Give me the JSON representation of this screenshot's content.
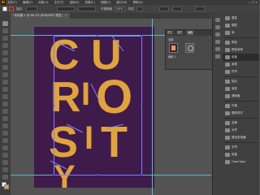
{
  "app": {
    "logo": "Ai"
  },
  "menu": [
    "文件(F)",
    "编辑(E)",
    "对象(O)",
    "文字(T)",
    "选择(S)",
    "效果(C)",
    "视图(V)",
    "窗口(W)",
    "帮助(H)"
  ],
  "window_controls": "— ☐ ✕",
  "control_bar": {
    "stroke_label": "描边",
    "opacity_label": "不透明度",
    "opacity_value": "100%",
    "style_label": "样式",
    "fill_color": "#ffffff",
    "stroke_color": "#d4463a"
  },
  "document_tab": {
    "label": "*未标题-1 @ 66.7% (RGB/GPU 预览)",
    "close": "×"
  },
  "artwork": {
    "letters": [
      "C",
      "U",
      "R",
      "I",
      "O",
      "S",
      "I",
      "T",
      "Y"
    ],
    "background_color": "#3f1b4b",
    "letter_color": "#e0a33d"
  },
  "panel": {
    "tabs": [
      "属性",
      "图层",
      "画板"
    ],
    "row_label": "全部",
    "thumb_label": "画板 1"
  },
  "dock": {
    "items": [
      "属性",
      "图层",
      "库",
      "颜色",
      "颜色参考",
      "色板",
      "画笔",
      "符号",
      "描边",
      "渐变",
      "透明度",
      "外观",
      "图形样式",
      "变换",
      "对齐",
      "路径查找器",
      "字符",
      "段落",
      "OpenType"
    ]
  }
}
